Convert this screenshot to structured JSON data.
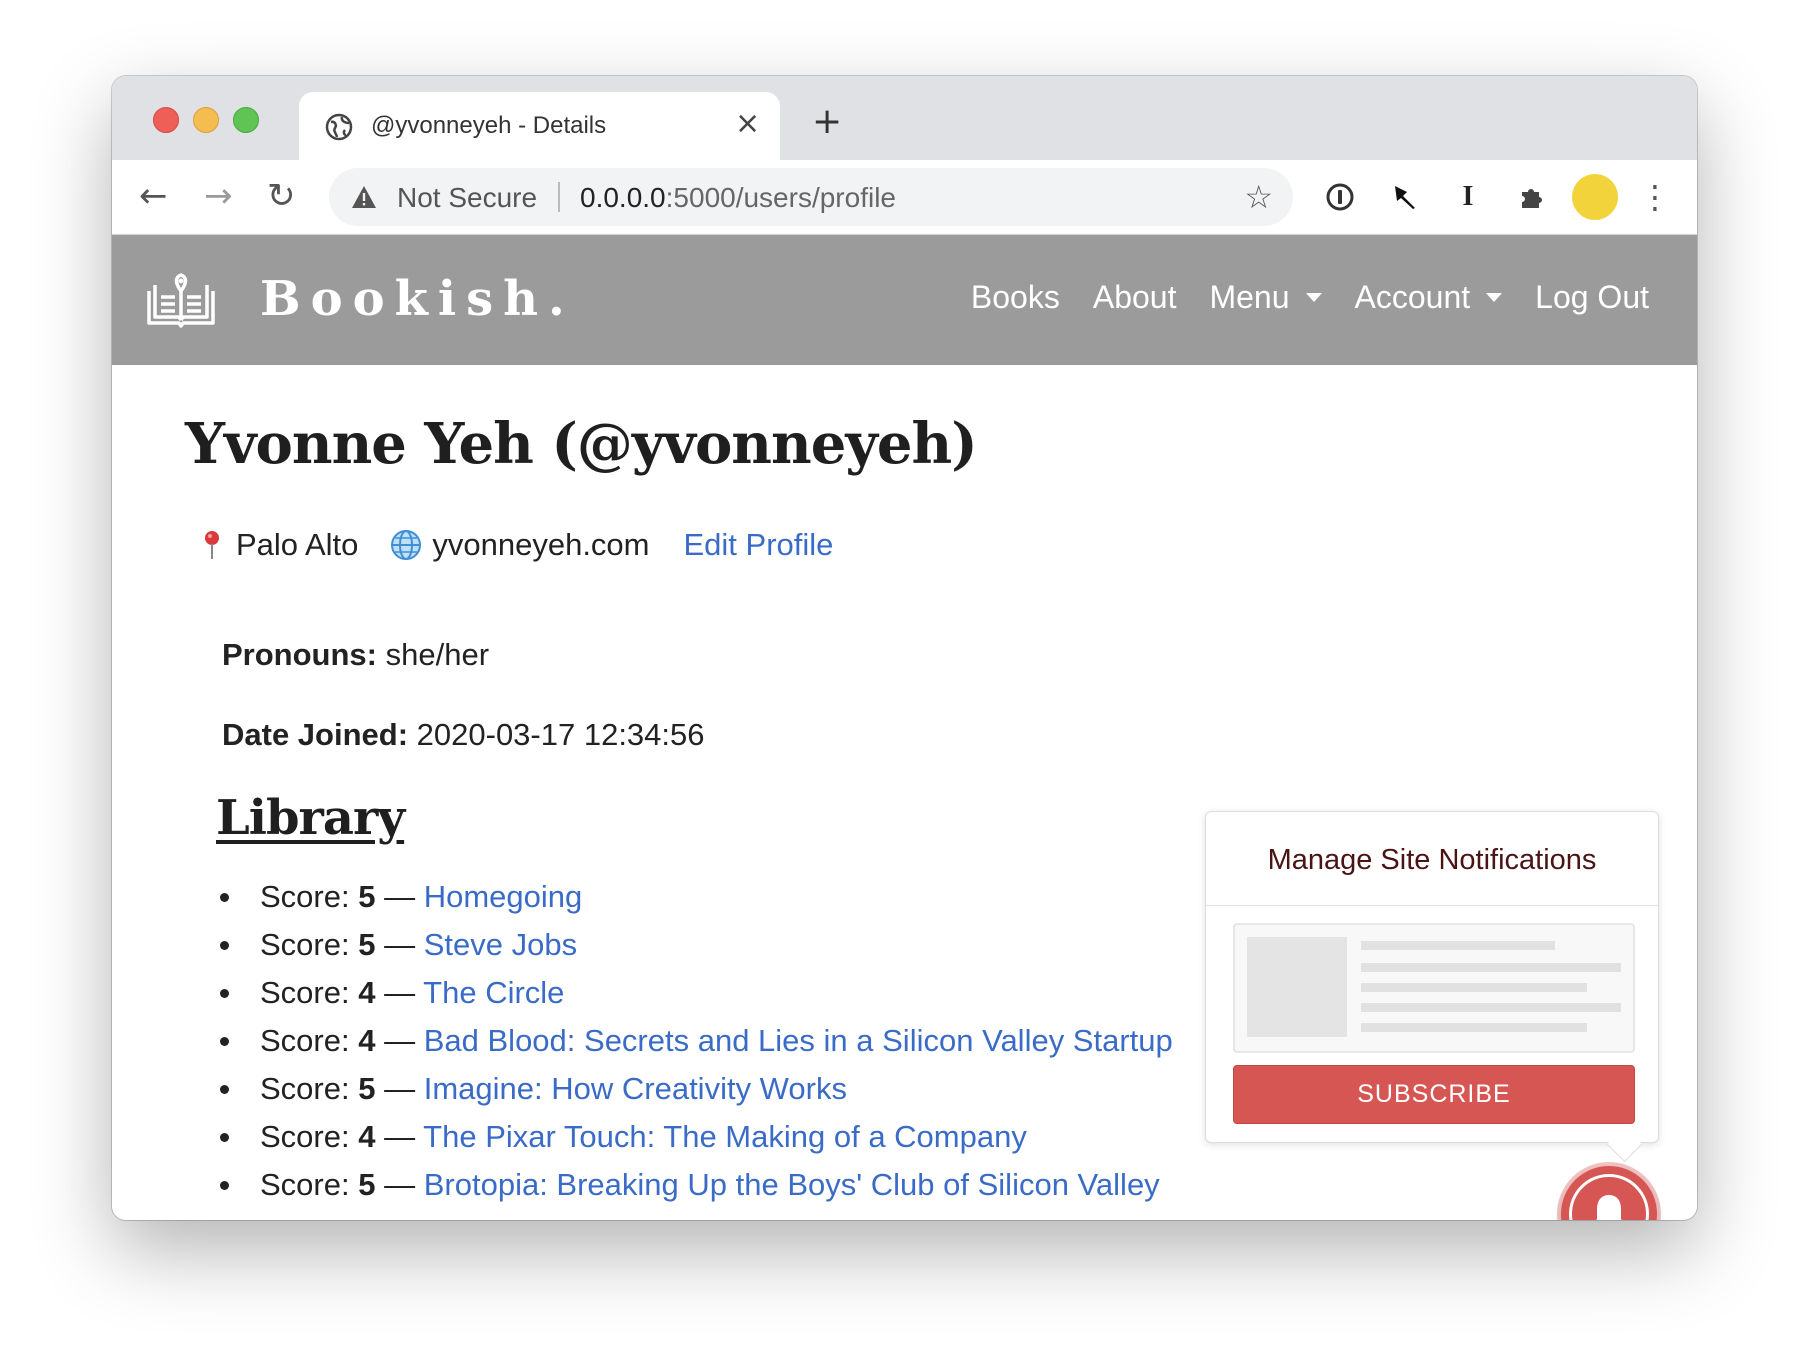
{
  "browser": {
    "tab_title": "@yvonneyeh - Details",
    "close_glyph": "×",
    "new_tab_glyph": "+",
    "security_label": "Not Secure",
    "url_host": "0.0.0.0",
    "url_path": ":5000/users/profile",
    "icons": [
      "back-arrow-icon",
      "forward-arrow-icon",
      "reload-icon",
      "warning-icon",
      "bookmark-star-icon",
      "password-manager-icon",
      "pin-extension-icon",
      "instapaper-icon",
      "extensions-puzzle-icon",
      "profile-avatar",
      "more-menu-icon"
    ]
  },
  "navbar": {
    "brand": "Bookish.",
    "links": {
      "books": "Books",
      "about": "About",
      "menu": "Menu",
      "account": "Account",
      "logout": "Log Out"
    }
  },
  "profile": {
    "title": "Yvonne Yeh (@yvonneyeh)",
    "location": "Palo Alto",
    "website": "yvonneyeh.com",
    "edit_label": "Edit Profile",
    "pronouns_label": "Pronouns:",
    "pronouns_value": "she/her",
    "joined_label": "Date Joined:",
    "joined_value": "2020-03-17 12:34:56"
  },
  "library": {
    "heading": "Library",
    "score_label": "Score:",
    "dash": "—",
    "books": [
      {
        "score": "5",
        "title": "Homegoing"
      },
      {
        "score": "5",
        "title": "Steve Jobs"
      },
      {
        "score": "4",
        "title": "The Circle"
      },
      {
        "score": "4",
        "title": "Bad Blood: Secrets and Lies in a Silicon Valley Startup"
      },
      {
        "score": "5",
        "title": "Imagine: How Creativity Works"
      },
      {
        "score": "4",
        "title": "The Pixar Touch: The Making of a Company"
      },
      {
        "score": "5",
        "title": "Brotopia: Breaking Up the Boys' Club of Silicon Valley"
      }
    ]
  },
  "notifications": {
    "title": "Manage Site Notifications",
    "subscribe_label": "SUBSCRIBE"
  },
  "colors": {
    "navbar_bg": "#9b9b9b",
    "link": "#3a6cc7",
    "subscribe": "#d65654",
    "tab_strip": "#dfe1e5"
  }
}
